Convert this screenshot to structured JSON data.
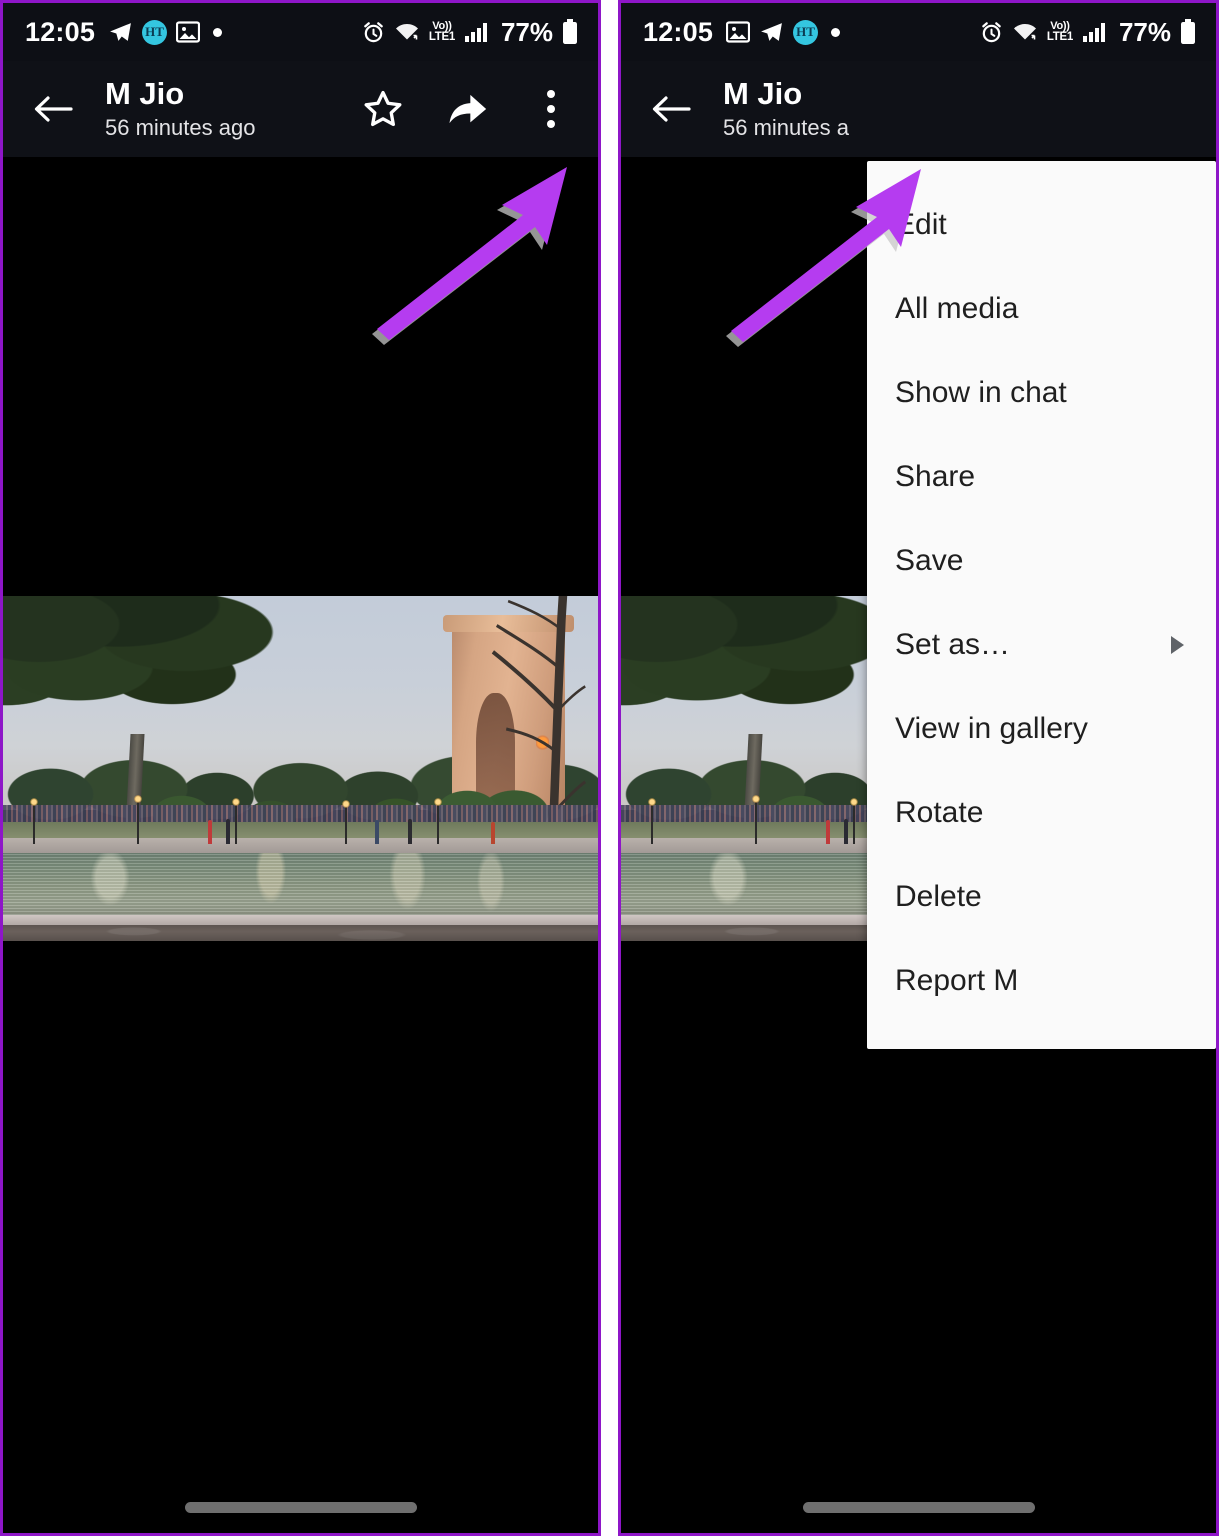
{
  "meta": {
    "accent_purple": "#b53cf0",
    "appbar_bg": "#0f1117",
    "menu_bg": "#fafafa",
    "panel_border": "#8e16c8"
  },
  "left_panel": {
    "status_bar": {
      "time": "12:05",
      "left_icons": [
        "telegram-icon",
        "ht-badge-icon",
        "image-icon",
        "dot-icon"
      ],
      "ht_badge_text": "HT",
      "right_icons": [
        "alarm-icon",
        "wifi-icon",
        "volte-icon",
        "signal-icon"
      ],
      "volte_top": "Vo))",
      "volte_bottom": "LTE1",
      "battery_percent": "77%"
    },
    "app_bar": {
      "back_label": "Back",
      "title": "M Jio",
      "subtitle": "56 minutes ago",
      "actions": [
        "star-icon",
        "forward-icon",
        "overflow-menu-icon"
      ]
    },
    "photo": {
      "alt": "India Gate at dusk with trees, lake and crowd"
    },
    "annotation": {
      "arrow_label": "arrow pointing to overflow menu"
    },
    "nav_bar": {
      "home_indicator": "home-indicator"
    }
  },
  "right_panel": {
    "status_bar": {
      "time": "12:05",
      "left_icons": [
        "image-icon",
        "telegram-icon",
        "ht-badge-icon",
        "dot-icon"
      ],
      "ht_badge_text": "HT",
      "right_icons": [
        "alarm-icon",
        "wifi-icon",
        "volte-icon",
        "signal-icon"
      ],
      "volte_top": "Vo))",
      "volte_bottom": "LTE1",
      "battery_percent": "77%"
    },
    "app_bar": {
      "back_label": "Back",
      "title": "M Jio",
      "subtitle": "56 minutes a"
    },
    "photo": {
      "alt": "India Gate at dusk with trees, lake and crowd"
    },
    "annotation": {
      "arrow_label": "arrow pointing to opened overflow menu"
    },
    "overflow_menu": {
      "items": [
        {
          "label": "Edit",
          "has_submenu": false
        },
        {
          "label": "All media",
          "has_submenu": false
        },
        {
          "label": "Show in chat",
          "has_submenu": false
        },
        {
          "label": "Share",
          "has_submenu": false
        },
        {
          "label": "Save",
          "has_submenu": false
        },
        {
          "label": "Set as…",
          "has_submenu": true
        },
        {
          "label": "View in gallery",
          "has_submenu": false
        },
        {
          "label": "Rotate",
          "has_submenu": false
        },
        {
          "label": "Delete",
          "has_submenu": false
        },
        {
          "label": "Report M",
          "has_submenu": false
        }
      ]
    },
    "nav_bar": {
      "home_indicator": "home-indicator"
    }
  }
}
